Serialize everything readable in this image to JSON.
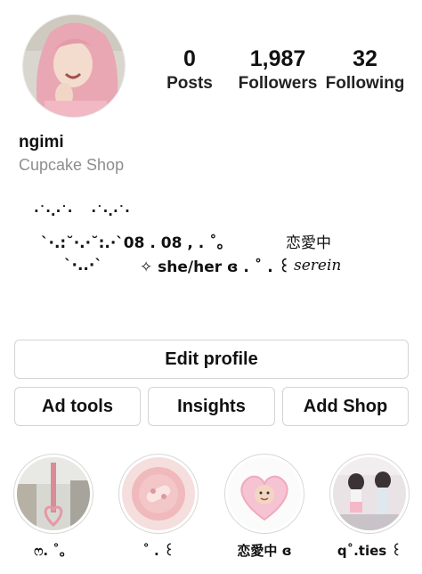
{
  "profile": {
    "username": "ngimi",
    "category": "Cupcake Shop"
  },
  "stats": {
    "posts": {
      "value": "0",
      "label": "Posts"
    },
    "followers": {
      "value": "1,987",
      "label": "Followers"
    },
    "following": {
      "value": "32",
      "label": "Following"
    }
  },
  "bio": {
    "line1": "·˙·.·˙·    ·˙·.·˙·",
    "line2": "`·.:˘·.·˘:.·`08 . 08 , . ˚。",
    "line2_right": "恋愛中",
    "line3": "`·..·`",
    "line3_mid": "✧ she/her ɞ . ˚ . ꒰",
    "line3_end": "serein"
  },
  "buttons": {
    "edit_profile": "Edit profile",
    "ad_tools": "Ad tools",
    "insights": "Insights",
    "add_shop": "Add Shop"
  },
  "highlights": [
    {
      "caption": "ෆ. ˚。"
    },
    {
      "caption": "˚ . ꒰"
    },
    {
      "caption": "恋愛中 ɞ"
    },
    {
      "caption": "q˚.ties ꒰"
    }
  ]
}
